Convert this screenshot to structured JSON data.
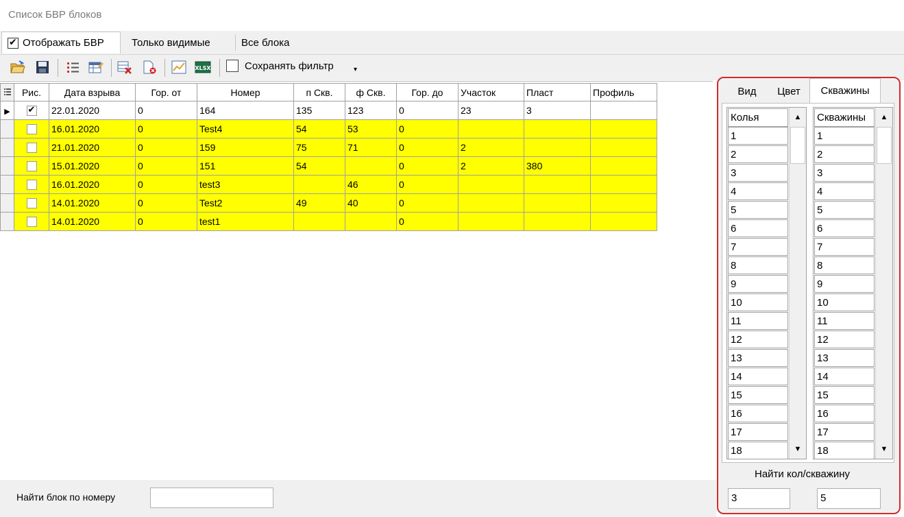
{
  "window": {
    "title": "Список БВР блоков"
  },
  "tabs": [
    {
      "label": "Отображать БВР",
      "checked": true
    },
    {
      "label": "Только видимые"
    },
    {
      "label": "Все блока"
    }
  ],
  "toolbar": {
    "buttons": [
      "open-folder-icon",
      "save-icon",
      "list-icon",
      "table-edit-icon",
      "delete-rows-icon",
      "delete-doc-icon",
      "chart-icon",
      "xlsx-export-icon"
    ],
    "save_filter_label": "Сохранять фильтр",
    "save_filter_checked": false,
    "dropdown_arrow": "▾"
  },
  "grid": {
    "columns": [
      "Рис.",
      "Дата взрыва",
      "Гор. от",
      "Номер",
      "п Скв.",
      "ф Скв.",
      "Гор. до",
      "Участок",
      "Пласт",
      "Профиль"
    ],
    "rows": [
      {
        "checked": true,
        "date": "22.01.2020",
        "gor_from": "0",
        "number": "164",
        "p_skv": "135",
        "f_skv": "123",
        "gor_to": "0",
        "section": "23",
        "plast": "3",
        "profile": "",
        "highlight": false
      },
      {
        "checked": false,
        "date": "16.01.2020",
        "gor_from": "0",
        "number": "Test4",
        "p_skv": "54",
        "f_skv": "53",
        "gor_to": "0",
        "section": "",
        "plast": "",
        "profile": "",
        "highlight": true
      },
      {
        "checked": false,
        "date": "21.01.2020",
        "gor_from": "0",
        "number": "159",
        "p_skv": "75",
        "f_skv": "71",
        "gor_to": "0",
        "section": "2",
        "plast": "",
        "profile": "",
        "highlight": true
      },
      {
        "checked": false,
        "date": "15.01.2020",
        "gor_from": "0",
        "number": "151",
        "p_skv": "54",
        "f_skv": "",
        "gor_to": "0",
        "section": "2",
        "plast": "380",
        "profile": "",
        "highlight": true
      },
      {
        "checked": false,
        "date": "16.01.2020",
        "gor_from": "0",
        "number": "test3",
        "p_skv": "",
        "f_skv": "46",
        "gor_to": "0",
        "section": "",
        "plast": "",
        "profile": "",
        "highlight": true
      },
      {
        "checked": false,
        "date": "14.01.2020",
        "gor_from": "0",
        "number": "Test2",
        "p_skv": "49",
        "f_skv": "40",
        "gor_to": "0",
        "section": "",
        "plast": "",
        "profile": "",
        "highlight": true
      },
      {
        "checked": false,
        "date": "14.01.2020",
        "gor_from": "0",
        "number": "test1",
        "p_skv": "",
        "f_skv": "",
        "gor_to": "0",
        "section": "",
        "plast": "",
        "profile": "",
        "highlight": true
      }
    ],
    "highlight_color": "#ffff00"
  },
  "find_block": {
    "label": "Найти блок по номеру",
    "value": ""
  },
  "right_panel": {
    "tabs": [
      "Вид",
      "Цвет",
      "Скважины"
    ],
    "active_tab": "Скважины",
    "left_list": {
      "header": "Колья",
      "items": [
        "1",
        "2",
        "3",
        "4",
        "5",
        "6",
        "7",
        "8",
        "9",
        "10",
        "11",
        "12",
        "13",
        "14",
        "15",
        "16",
        "17",
        "18"
      ]
    },
    "right_list": {
      "header": "Скважины",
      "items": [
        "1",
        "2",
        "3",
        "4",
        "5",
        "6",
        "7",
        "8",
        "9",
        "10",
        "11",
        "12",
        "13",
        "14",
        "15",
        "16",
        "17",
        "18"
      ]
    },
    "find_label": "Найти кол/скважину",
    "find_kol_value": "3",
    "find_well_value": "5",
    "border_color": "#d42a2a"
  }
}
